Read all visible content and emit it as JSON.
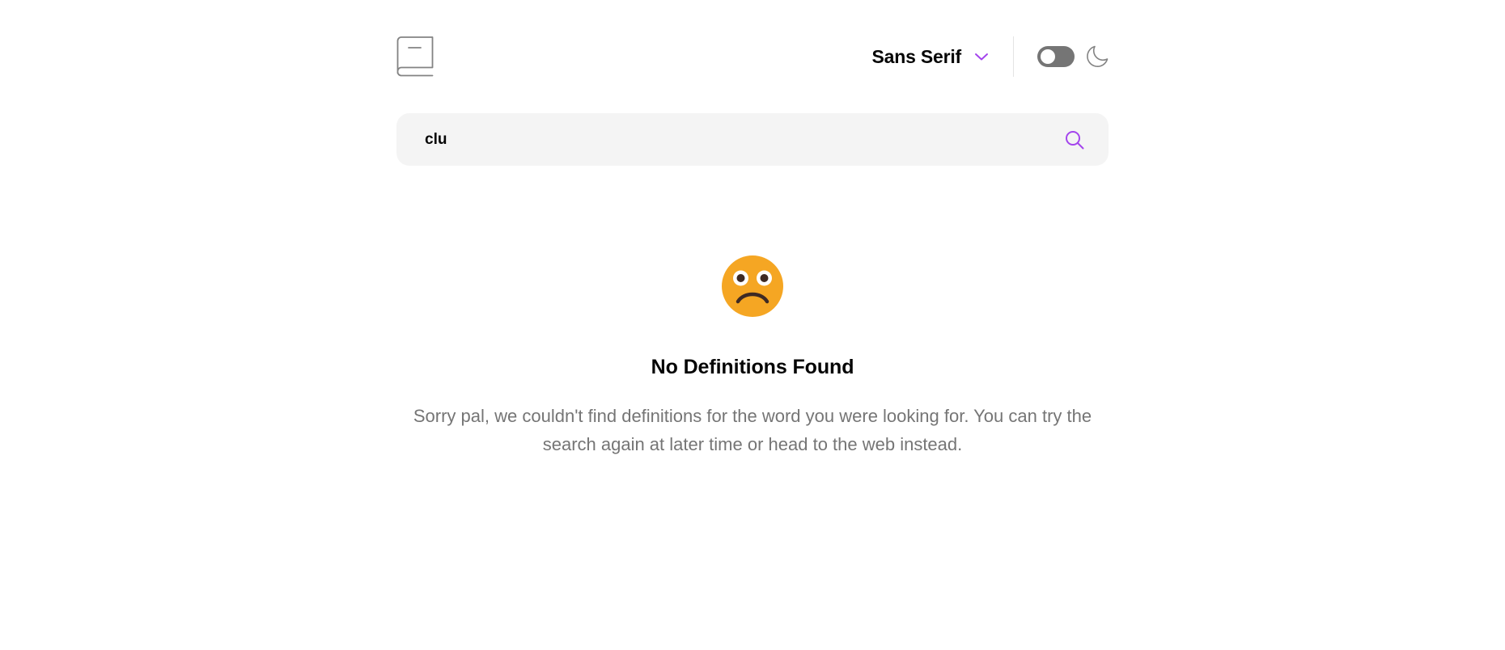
{
  "header": {
    "logo_icon": "book-icon",
    "font_selector": {
      "selected": "Sans Serif",
      "icon": "chevron-down-icon"
    },
    "theme_toggle": {
      "state": "off",
      "icon": "moon-icon"
    }
  },
  "search": {
    "value": "clu",
    "icon": "search-icon"
  },
  "empty_state": {
    "emoji": "confused-face-emoji",
    "title": "No Definitions Found",
    "message": "Sorry pal, we couldn't find definitions for the word you were looking for. You can try the search again at later time or head to the web instead."
  },
  "colors": {
    "accent": "#a445ed",
    "text_primary": "#050505",
    "text_secondary": "#757575",
    "search_bg": "#f4f4f4",
    "emoji": "#f5a623"
  }
}
